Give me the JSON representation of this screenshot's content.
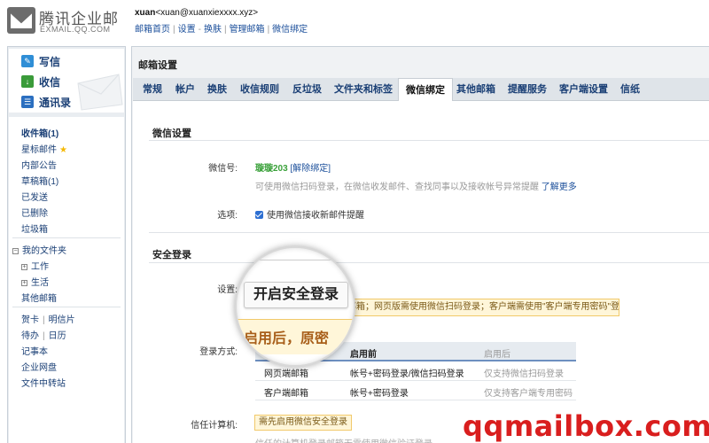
{
  "header": {
    "logo_cn": "腾讯企业邮",
    "logo_en": "EXMAIL.QQ.COM",
    "user_name": "xuan",
    "user_email": "<xuan@xuanxiexxxx.xyz>",
    "nav": [
      "邮箱首页",
      "设置",
      "换肤",
      "管理邮箱",
      "微信绑定"
    ]
  },
  "sidebar": {
    "quick": [
      {
        "label": "写信",
        "icon": "pencil-icon"
      },
      {
        "label": "收信",
        "icon": "inbox-download-icon"
      },
      {
        "label": "通讯录",
        "icon": "contacts-icon"
      }
    ],
    "folders": {
      "inbox": "收件箱(1)",
      "starred": "星标邮件",
      "announce": "内部公告",
      "drafts": "草稿箱(1)",
      "sent": "已发送",
      "deleted": "已删除",
      "spam": "垃圾箱",
      "my_folders": "我的文件夹",
      "work": "工作",
      "life": "生活",
      "other": "其他邮箱",
      "card": "贺卡",
      "postcard": "明信片",
      "todo": "待办",
      "calendar": "日历",
      "notes": "记事本",
      "disk": "企业网盘",
      "transfer": "文件中转站"
    }
  },
  "main": {
    "title": "邮箱设置",
    "tabs": [
      "常规",
      "帐户",
      "换肤",
      "收信规则",
      "反垃圾",
      "文件夹和标签",
      "微信绑定",
      "其他邮箱",
      "提醒服务",
      "客户端设置",
      "信纸"
    ],
    "active_tab": "微信绑定"
  },
  "wechat": {
    "section_title": "微信设置",
    "account_label": "微信号:",
    "account_value": "璇璇203",
    "unbind": "[解除绑定]",
    "desc": "可使用微信扫码登录，在微信收发邮件、查找同事以及接收帐号异常提醒",
    "learn_more": "了解更多",
    "option_label": "选项:",
    "option_text": "使用微信接收新邮件提醒"
  },
  "security": {
    "section_title": "安全登录",
    "setting_label": "设置:",
    "notice": "邮箱；网页版需使用微信扫码登录；客户端需使用\"客户端专用密码\"登录",
    "login_label": "登录方式:",
    "table_headers": [
      "登录",
      "启用前",
      "启用后"
    ],
    "rows": [
      {
        "type": "网页端邮箱",
        "before": "帐号+密码登录/微信扫码登录",
        "after": "仅支持微信扫码登录"
      },
      {
        "type": "客户端邮箱",
        "before": "帐号+密码登录",
        "after": "仅支持客户端专用密码"
      }
    ],
    "trust_label": "信任计算机:",
    "trust_button": "需先启用微信安全登录",
    "trust_desc": "信任的计算机登录邮箱无需使用微信验证登录"
  },
  "magnifier": {
    "button": "开启安全登录",
    "text": "启用后，原密"
  },
  "watermark": "qqmailbox.com",
  "colors": {
    "link": "#1a4e9a",
    "green": "#3aa13a",
    "notice_bg": "#fff6d9",
    "notice_border": "#f1c96a",
    "watermark": "#d91e1e"
  }
}
